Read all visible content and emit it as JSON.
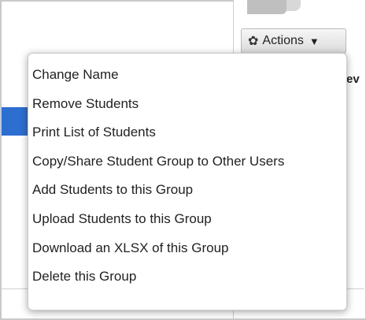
{
  "actions_button": {
    "label": "Actions",
    "icon": "gear-icon",
    "caret_icon": "caret-down-icon"
  },
  "table": {
    "header_partial": "ev"
  },
  "menu": {
    "items": [
      {
        "label": "Change Name"
      },
      {
        "label": "Remove Students"
      },
      {
        "label": "Print List of Students"
      },
      {
        "label": "Copy/Share Student Group to Other Users"
      },
      {
        "label": "Add Students to this Group"
      },
      {
        "label": "Upload Students to this Group"
      },
      {
        "label": "Download an XLSX of this Group"
      },
      {
        "label": "Delete this Group"
      }
    ]
  },
  "colors": {
    "selected_row": "#2d6ed1",
    "menu_border": "#c8c8c8",
    "text": "#222222"
  }
}
